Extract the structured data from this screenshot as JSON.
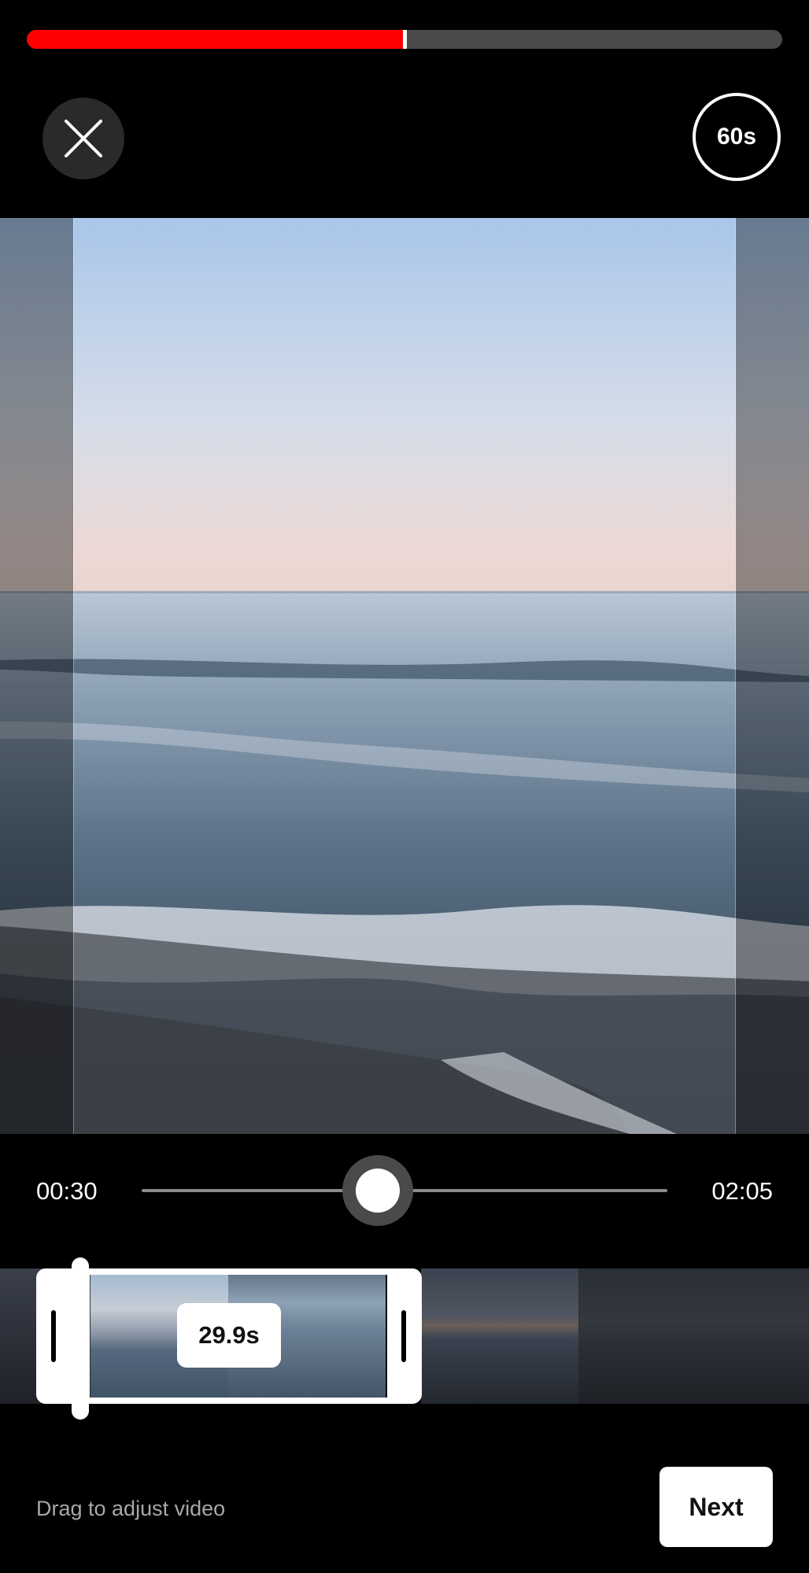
{
  "progress": {
    "value": 0.5,
    "fill_color": "#ff0000"
  },
  "header": {
    "close_icon": "close-icon",
    "duration_label": "60s"
  },
  "scrubber": {
    "start_time": "00:30",
    "end_time": "02:05",
    "value": 0.5
  },
  "filmstrip": {
    "selection_label": "29.9s"
  },
  "footer": {
    "hint": "Drag to adjust video",
    "next_label": "Next"
  }
}
